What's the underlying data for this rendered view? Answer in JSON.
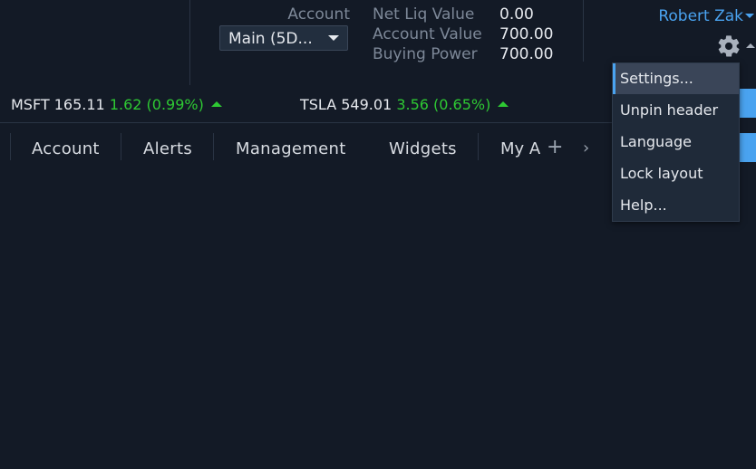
{
  "header": {
    "account_label": "Account",
    "account_selected": "Main (5D...",
    "metrics": [
      {
        "label": "Net Liq Value",
        "value": "0.00"
      },
      {
        "label": "Account Value",
        "value": "700.00"
      },
      {
        "label": "Buying Power",
        "value": "700.00"
      }
    ],
    "user_name": "Robert Zak"
  },
  "tickers": [
    {
      "symbol": "MSFT",
      "price": "165.11",
      "change": "1.62 (0.99%)"
    },
    {
      "symbol": "TSLA",
      "price": "549.01",
      "change": "3.56 (0.65%)"
    }
  ],
  "tabs": [
    {
      "label": "Account"
    },
    {
      "label": "Alerts"
    },
    {
      "label": "Management"
    },
    {
      "label": "Widgets"
    },
    {
      "label": "My A"
    }
  ],
  "settings_menu": {
    "items": [
      {
        "label": "Settings..."
      },
      {
        "label": "Unpin header"
      },
      {
        "label": "Language"
      },
      {
        "label": "Lock layout"
      },
      {
        "label": "Help..."
      }
    ]
  },
  "colors": {
    "background": "#131a26",
    "accent": "#4aa3f0",
    "positive": "#2ec933",
    "menu_bg": "#1f2a39"
  },
  "icons": {
    "gear": "gear-icon",
    "add_tab": "plus-icon",
    "tabs_next": "chevron-right-icon",
    "dropdown": "caret-down-icon",
    "up_arrow": "triangle-up-icon"
  }
}
